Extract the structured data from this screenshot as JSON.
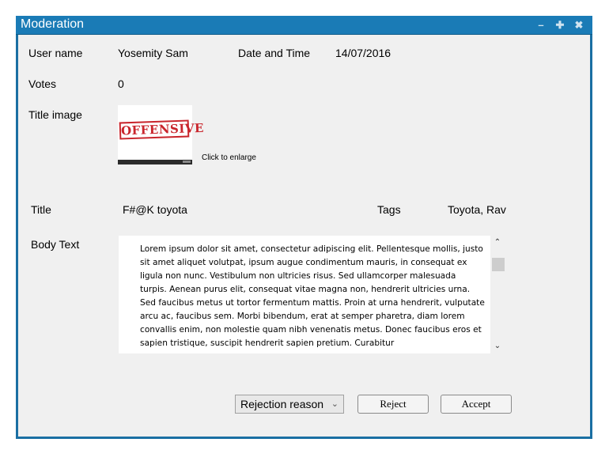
{
  "window": {
    "title": "Moderation",
    "controls": [
      "minimize",
      "maximize",
      "close"
    ]
  },
  "fields": {
    "user_name_label": "User name",
    "user_name_value": "Yosemity Sam",
    "datetime_label": "Date and Time",
    "datetime_value": "14/07/2016",
    "votes_label": "Votes",
    "votes_value": "0",
    "title_image_label": "Title image",
    "title_image_stamp": "OFFENSIVE",
    "enlarge_hint": "Click to enlarge",
    "title_label": "Title",
    "title_value": "F#@K toyota",
    "tags_label": "Tags",
    "tags_value": "Toyota, Rav",
    "body_label": "Body Text",
    "body_text": "Lorem ipsum dolor sit amet, consectetur adipiscing elit. Pellentesque mollis, justo sit amet aliquet volutpat, ipsum augue condimentum mauris, in consequat ex ligula non nunc. Vestibulum non ultricies risus. Sed ullamcorper malesuada turpis. Aenean purus elit, consequat vitae magna non, hendrerit ultricies urna. Sed faucibus metus ut tortor fermentum mattis. Proin at urna hendrerit, vulputate arcu ac, faucibus sem. Morbi bibendum, erat at semper pharetra, diam lorem convallis enim, non molestie quam nibh venenatis metus. Donec faucibus eros et sapien tristique, suscipit hendrerit sapien pretium. Curabitur"
  },
  "actions": {
    "rejection_reason": "Rejection reason",
    "reject_label": "Reject",
    "accept_label": "Accept"
  },
  "icons": {
    "minimize": "minimize-icon",
    "maximize": "plus-icon",
    "close": "close-icon",
    "scroll_up": "chevron-up-icon",
    "scroll_down": "chevron-down-icon",
    "select_arrow": "chevron-down-icon"
  },
  "colors": {
    "titlebar": "#1a7bb6",
    "frame": "#1a6fa3",
    "stamp": "#c9252c"
  }
}
